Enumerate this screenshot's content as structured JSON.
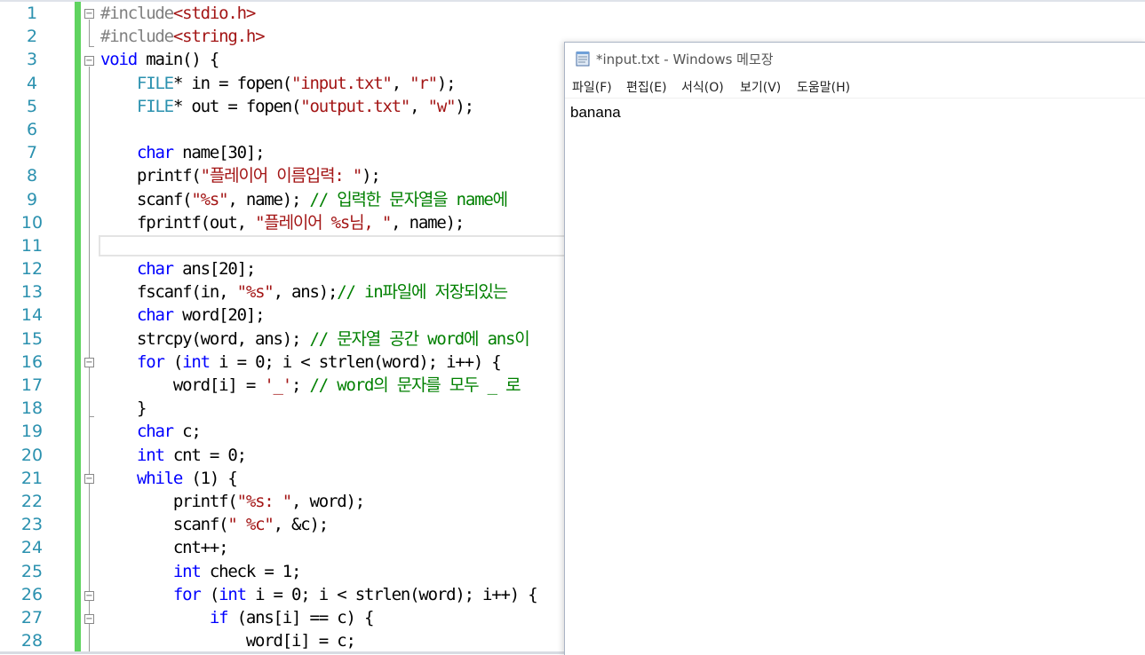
{
  "editor": {
    "line_numbers": [
      "1",
      "2",
      "3",
      "4",
      "5",
      "6",
      "7",
      "8",
      "9",
      "10",
      "11",
      "12",
      "13",
      "14",
      "15",
      "16",
      "17",
      "18",
      "19",
      "20",
      "21",
      "22",
      "23",
      "24",
      "25",
      "26",
      "27",
      "28"
    ],
    "lines": [
      [
        {
          "t": "#include",
          "c": "pp"
        },
        {
          "t": "<stdio.h>",
          "c": "str"
        }
      ],
      [
        {
          "t": "#include",
          "c": "pp"
        },
        {
          "t": "<string.h>",
          "c": "str"
        }
      ],
      [
        {
          "t": "void",
          "c": "kw"
        },
        {
          "t": " main() {",
          "c": ""
        }
      ],
      [
        {
          "t": "    ",
          "c": ""
        },
        {
          "t": "FILE",
          "c": "ty"
        },
        {
          "t": "* in = fopen(",
          "c": ""
        },
        {
          "t": "\"input.txt\"",
          "c": "str"
        },
        {
          "t": ", ",
          "c": ""
        },
        {
          "t": "\"r\"",
          "c": "str"
        },
        {
          "t": ");",
          "c": ""
        }
      ],
      [
        {
          "t": "    ",
          "c": ""
        },
        {
          "t": "FILE",
          "c": "ty"
        },
        {
          "t": "* out = fopen(",
          "c": ""
        },
        {
          "t": "\"output.txt\"",
          "c": "str"
        },
        {
          "t": ", ",
          "c": ""
        },
        {
          "t": "\"w\"",
          "c": "str"
        },
        {
          "t": ");",
          "c": ""
        }
      ],
      [
        {
          "t": "",
          "c": ""
        }
      ],
      [
        {
          "t": "    ",
          "c": ""
        },
        {
          "t": "char",
          "c": "kw"
        },
        {
          "t": " name[30];",
          "c": ""
        }
      ],
      [
        {
          "t": "    printf(",
          "c": ""
        },
        {
          "t": "\"플레이어 이름입력: \"",
          "c": "str"
        },
        {
          "t": ");",
          "c": ""
        }
      ],
      [
        {
          "t": "    scanf(",
          "c": ""
        },
        {
          "t": "\"%s\"",
          "c": "str"
        },
        {
          "t": ", name); ",
          "c": ""
        },
        {
          "t": "// 입력한 문자열을 name에",
          "c": "cm"
        }
      ],
      [
        {
          "t": "    fprintf(out, ",
          "c": ""
        },
        {
          "t": "\"플레이어 %s님, \"",
          "c": "str"
        },
        {
          "t": ", name);",
          "c": ""
        }
      ],
      [
        {
          "t": "",
          "c": ""
        }
      ],
      [
        {
          "t": "    ",
          "c": ""
        },
        {
          "t": "char",
          "c": "kw"
        },
        {
          "t": " ans[20];",
          "c": ""
        }
      ],
      [
        {
          "t": "    fscanf(in, ",
          "c": ""
        },
        {
          "t": "\"%s\"",
          "c": "str"
        },
        {
          "t": ", ans);",
          "c": ""
        },
        {
          "t": "// in파일에 저장되있는",
          "c": "cm"
        }
      ],
      [
        {
          "t": "    ",
          "c": ""
        },
        {
          "t": "char",
          "c": "kw"
        },
        {
          "t": " word[20];",
          "c": ""
        }
      ],
      [
        {
          "t": "    strcpy(word, ans); ",
          "c": ""
        },
        {
          "t": "// 문자열 공간 word에 ans이",
          "c": "cm"
        }
      ],
      [
        {
          "t": "    ",
          "c": ""
        },
        {
          "t": "for",
          "c": "kw"
        },
        {
          "t": " (",
          "c": ""
        },
        {
          "t": "int",
          "c": "kw"
        },
        {
          "t": " i = 0; i < strlen(word); i++) {",
          "c": ""
        }
      ],
      [
        {
          "t": "        word[i] = ",
          "c": ""
        },
        {
          "t": "'_'",
          "c": "str"
        },
        {
          "t": "; ",
          "c": ""
        },
        {
          "t": "// word의 문자를 모두 _ 로",
          "c": "cm"
        }
      ],
      [
        {
          "t": "    }",
          "c": ""
        }
      ],
      [
        {
          "t": "    ",
          "c": ""
        },
        {
          "t": "char",
          "c": "kw"
        },
        {
          "t": " c;",
          "c": ""
        }
      ],
      [
        {
          "t": "    ",
          "c": ""
        },
        {
          "t": "int",
          "c": "kw"
        },
        {
          "t": " cnt = 0;",
          "c": ""
        }
      ],
      [
        {
          "t": "    ",
          "c": ""
        },
        {
          "t": "while",
          "c": "kw"
        },
        {
          "t": " (1) {",
          "c": ""
        }
      ],
      [
        {
          "t": "        printf(",
          "c": ""
        },
        {
          "t": "\"%s: \"",
          "c": "str"
        },
        {
          "t": ", word);",
          "c": ""
        }
      ],
      [
        {
          "t": "        scanf(",
          "c": ""
        },
        {
          "t": "\" %c\"",
          "c": "str"
        },
        {
          "t": ", &c);",
          "c": ""
        }
      ],
      [
        {
          "t": "        cnt++;",
          "c": ""
        }
      ],
      [
        {
          "t": "        ",
          "c": ""
        },
        {
          "t": "int",
          "c": "kw"
        },
        {
          "t": " check = 1;",
          "c": ""
        }
      ],
      [
        {
          "t": "        ",
          "c": ""
        },
        {
          "t": "for",
          "c": "kw"
        },
        {
          "t": " (",
          "c": ""
        },
        {
          "t": "int",
          "c": "kw"
        },
        {
          "t": " i = 0; i < strlen(word); i++) {",
          "c": ""
        }
      ],
      [
        {
          "t": "            ",
          "c": ""
        },
        {
          "t": "if",
          "c": "kw"
        },
        {
          "t": " (ans[i] == c) {",
          "c": ""
        }
      ],
      [
        {
          "t": "                word[i] = c;",
          "c": ""
        }
      ]
    ]
  },
  "notepad": {
    "title": "*input.txt - Windows 메모장",
    "menu": [
      "파일(F)",
      "편집(E)",
      "서식(O)",
      "보기(V)",
      "도움말(H)"
    ],
    "content": "banana"
  },
  "colors": {
    "keyword": "#0000ff",
    "string": "#a31515",
    "comment": "#008000",
    "preprocessor": "#808080",
    "type": "#2b91af",
    "change_bar": "#5fd35f"
  }
}
